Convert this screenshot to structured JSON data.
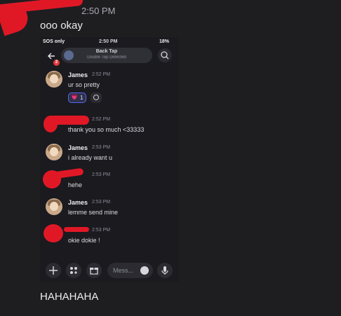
{
  "chat": {
    "header_time": "2:50 PM",
    "message_top": "ooo okay",
    "message_bottom": "HAHAHAHA"
  },
  "screenshot": {
    "status_bar": {
      "left": "SOS only",
      "center": "2:50 PM",
      "battery": "18%"
    },
    "topbar": {
      "pill_title": "Back Tap",
      "pill_subtitle": "Double Tap Detected",
      "badge_count": "2"
    },
    "messages": [
      {
        "author": "James",
        "time": "2:52 PM",
        "text": "ur so pretty"
      },
      {
        "author": "",
        "time": "2:52 PM",
        "text": "thank you so much <33333"
      },
      {
        "author": "James",
        "time": "2:53 PM",
        "text": "i already want u"
      },
      {
        "author": "",
        "time": "2:53 PM",
        "text": "hehe"
      },
      {
        "author": "James",
        "time": "2:53 PM",
        "text": "lemme send mine"
      },
      {
        "author": "",
        "time": "2:53 PM",
        "text": "okie dokie !"
      }
    ],
    "reaction": {
      "emoji": "💗",
      "count": "1"
    },
    "input": {
      "placeholder": "Mess..."
    }
  },
  "colors": {
    "background": "#1e1e21",
    "redaction": "#e01826",
    "reaction_border": "#5865f2"
  }
}
